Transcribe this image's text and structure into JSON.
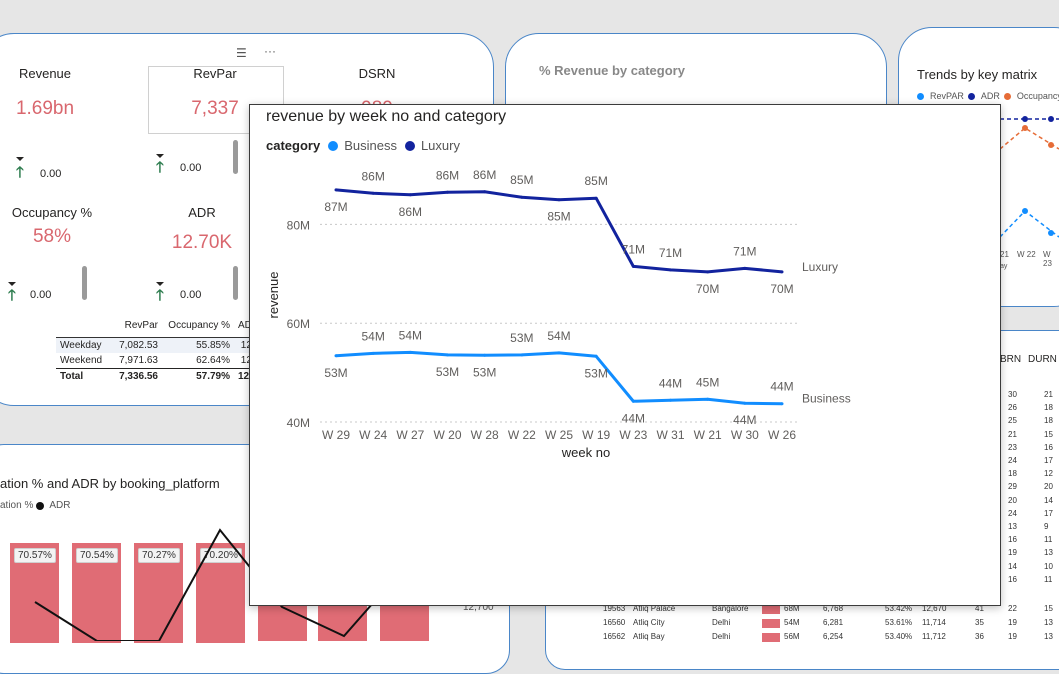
{
  "kpis": {
    "revenue": {
      "title": "Revenue",
      "value": "1.69bn",
      "change": "0.00"
    },
    "revpar": {
      "title": "RevPar",
      "value": "7,337",
      "change": "0.00"
    },
    "dsrn": {
      "title": "DSRN",
      "value": "989"
    },
    "occupancy": {
      "title": "Occupancy %",
      "value": "58%",
      "change": "0.00"
    },
    "adr": {
      "title": "ADR",
      "value": "12.70K",
      "change": "0.00"
    }
  },
  "summary_table": {
    "headers": [
      "",
      "RevPar",
      "Occupancy %",
      "AD"
    ],
    "rows": [
      [
        "Weekday",
        "7,082.53",
        "55.85%",
        "12"
      ],
      [
        "Weekend",
        "7,971.63",
        "62.64%",
        "12"
      ]
    ],
    "total": [
      "Total",
      "7,336.56",
      "57.79%",
      "12,"
    ]
  },
  "category_card": {
    "title": "% Revenue by category"
  },
  "trends_card": {
    "title": "Trends by key matrix",
    "legend": [
      "RevPAR",
      "ADR",
      "Occupancy%"
    ],
    "legend_colors": [
      "#118dff",
      "#12239e",
      "#e66c37"
    ],
    "x_ticks": [
      "21",
      "W 22",
      "W 23"
    ],
    "x_suffix": "ay"
  },
  "platform_card": {
    "title": "ation % and ADR by booking_platform",
    "legend_text": "ation %",
    "legend_adr": "ADR",
    "bar_labels": [
      "70.57%",
      "70.54%",
      "70.27%",
      "70.20%"
    ],
    "value_label": "12,700"
  },
  "hotel_table": {
    "headers": [
      "BRN",
      "DURN"
    ],
    "col_values": [
      [
        "30",
        "21"
      ],
      [
        "26",
        "18"
      ],
      [
        "25",
        "18"
      ],
      [
        "21",
        "15"
      ],
      [
        "23",
        "16"
      ],
      [
        "24",
        "17"
      ],
      [
        "18",
        "12"
      ],
      [
        "29",
        "20"
      ],
      [
        "20",
        "14"
      ],
      [
        "24",
        "17"
      ],
      [
        "13",
        "9"
      ],
      [
        "16",
        "11"
      ],
      [
        "19",
        "13"
      ],
      [
        "14",
        "10"
      ],
      [
        "16",
        "11"
      ]
    ],
    "bottom_rows": [
      [
        "19563",
        "Atliq Palace",
        "Bangalore",
        "68M",
        "6,768",
        "53.42%",
        "12,670",
        "41",
        "22",
        "15"
      ],
      [
        "16560",
        "Atliq City",
        "Delhi",
        "54M",
        "6,281",
        "53.61%",
        "11,714",
        "35",
        "19",
        "13"
      ],
      [
        "16562",
        "Atliq Bay",
        "Delhi",
        "56M",
        "6,254",
        "53.40%",
        "11,712",
        "36",
        "19",
        "13"
      ]
    ]
  },
  "focus_chart": {
    "title": "revenue by week no and category",
    "legend_title": "category",
    "more_icon": "more-options-icon",
    "filter_icon": "filter-icon"
  },
  "chart_data": {
    "type": "line",
    "title": "revenue by week no and category",
    "xlabel": "week no",
    "ylabel": "revenue",
    "categories": [
      "W 29",
      "W 24",
      "W 27",
      "W 20",
      "W 28",
      "W 22",
      "W 25",
      "W 19",
      "W 23",
      "W 31",
      "W 21",
      "W 30",
      "W 26"
    ],
    "ylim": [
      40,
      90
    ],
    "y_ticks": [
      "40M",
      "60M",
      "80M"
    ],
    "y_tick_values": [
      40,
      60,
      80
    ],
    "legend_position": "top-left",
    "series": [
      {
        "name": "Luxury",
        "color": "#12239e",
        "values": [
          87,
          86.3,
          86,
          86.5,
          86.6,
          85.5,
          85,
          85.3,
          71.5,
          70.8,
          70.4,
          71.1,
          70.4
        ],
        "labels": [
          "87M",
          "86M",
          "86M",
          "86M",
          "86M",
          "85M",
          "85M",
          "85M",
          "71M",
          "71M",
          "70M",
          "71M",
          "70M"
        ]
      },
      {
        "name": "Business",
        "color": "#118dff",
        "values": [
          53.4,
          53.9,
          54.1,
          53.6,
          53.5,
          53.6,
          54,
          53.3,
          44.2,
          44.4,
          44.6,
          43.8,
          43.7
        ],
        "labels": [
          "53M",
          "54M",
          "54M",
          "53M",
          "53M",
          "53M",
          "54M",
          "53M",
          "44M",
          "44M",
          "45M",
          "44M",
          "44M"
        ]
      }
    ],
    "grid": true
  }
}
